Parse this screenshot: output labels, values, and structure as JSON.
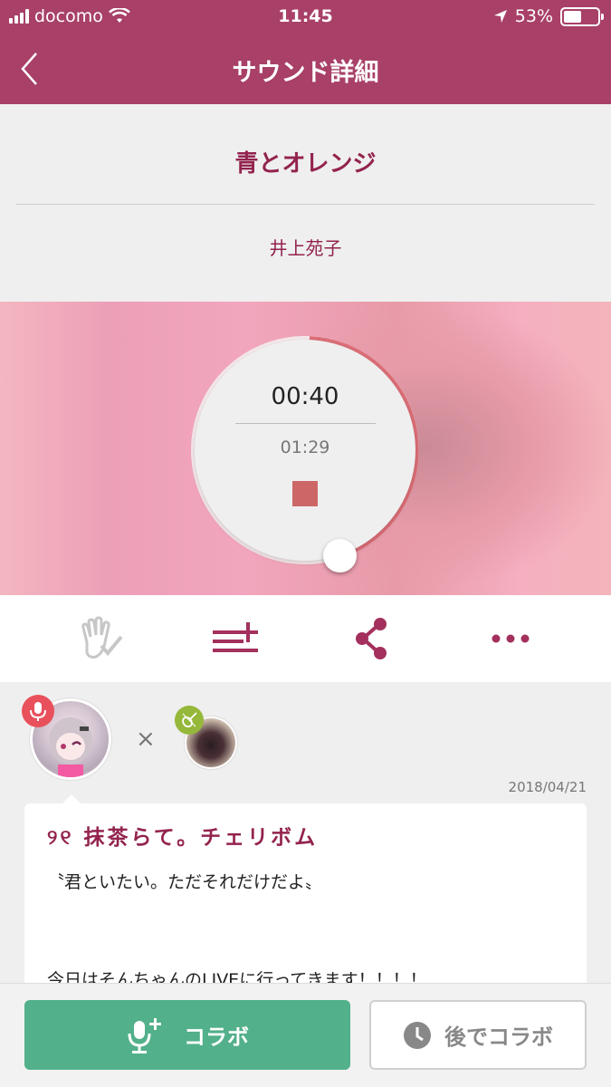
{
  "status_bar": {
    "carrier": "docomo",
    "time": "11:45",
    "battery": "53%",
    "battery_level": 0.53
  },
  "nav": {
    "title": "サウンド詳細",
    "back_icon": "chevron-left-icon"
  },
  "song": {
    "title": "青とオレンジ",
    "artist": "井上苑子"
  },
  "player": {
    "elapsed": "00:40",
    "total": "01:29",
    "progress_fraction": 0.449,
    "stop_icon": "stop-icon"
  },
  "actions": {
    "icons": [
      "clap-icon",
      "add-to-playlist-icon",
      "share-icon",
      "more-icon"
    ]
  },
  "collab": {
    "date": "2018/04/21",
    "user_name": "୨୧ 抹茶らて。チェリボム",
    "comment_lines": [
      "〝君といたい。ただそれだけだよ〟",
      "",
      "",
      "今日はそんちゃんのLIVEに行ってきます！！！！"
    ]
  },
  "bottom": {
    "collab_label": "コラボ",
    "later_label": "後でコラボ"
  },
  "colors": {
    "brand": "#a84068",
    "accent_text": "#93234e",
    "collab_green": "#52b08a",
    "stop_red": "#cd6767"
  }
}
